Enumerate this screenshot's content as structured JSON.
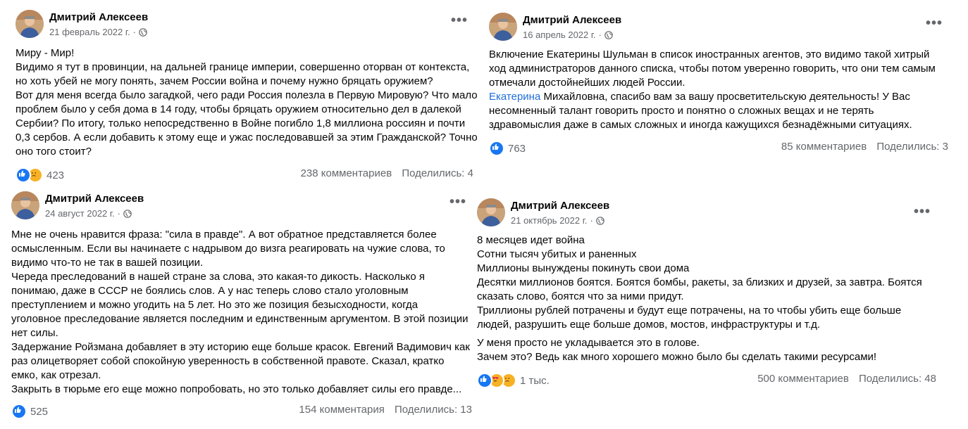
{
  "posts": [
    {
      "author": "Дмитрий Алексеев",
      "date": "21 февраль 2022 г.",
      "lines": [
        "Миру - Мир!",
        "Видимо я тут в провинции, на дальней границе империи, совершенно оторван от контекста,",
        "но хоть убей не могу понять, зачем России война и почему нужно бряцать оружием?",
        "Вот для меня всегда было загадкой, чего ради Россия полезла в Первую Мировую? Что мало",
        "проблем было у себя дома в 14 году, чтобы бряцать оружием относительно дел в далекой",
        "Сербии? По итогу, только непосредственно в Войне погибло 1,8 миллиона россиян и почти",
        "0,3 сербов. А если добавить к этому еще и ужас последовавшей за этим Гражданской? Точно",
        "оно того стоит?"
      ],
      "reaction_count": "423",
      "comments": "238 комментариев",
      "shares": "Поделились: 4"
    },
    {
      "author": "Дмитрий Алексеев",
      "date": "16 апрель 2022 г.",
      "lines": [
        "Включение Екатерины Шульман в список иностранных агентов, это видимо такой хитрый",
        "ход администраторов данного списка, чтобы потом уверенно говорить, что они тем самым",
        "отмечали достойнейших людей России."
      ],
      "link_word": "Екатерина",
      "link_line_rest": " Михайловна, спасибо вам за вашу просветительскую деятельность! У Вас",
      "lines2": [
        "несомненный талант говорить просто и понятно о сложных вещах и не терять",
        "здравомыслия даже в самых сложных и иногда кажущихся безнадёжными ситуациях."
      ],
      "reaction_count": "763",
      "comments": "85 комментариев",
      "shares": "Поделились: 3"
    },
    {
      "author": "Дмитрий Алексеев",
      "date": "24 август 2022 г.",
      "lines": [
        "Мне не очень нравится фраза: \"сила в правде\". А вот обратное представляется более",
        "осмысленным. Если вы начинаете с надрывом до визга реагировать на чужие слова, то",
        "видимо что-то не так в вашей позиции.",
        "Череда преследований в нашей стране за слова, это какая-то дикость. Насколько я",
        "понимаю, даже в СССР не боялись слов. А у нас теперь слово стало уголовным",
        "преступлением и можно угодить на 5 лет. Но это же позиция безысходности, когда",
        "уголовное преследование является последним и единственным аргументом. В этой позиции",
        "нет силы.",
        "Задержание Ройзмана добавляет в эту историю еще больше красок. Евгений Вадимович как",
        "раз олицетворяет собой спокойную уверенность в собственной правоте. Сказал, кратко",
        "емко, как отрезал.",
        "Закрыть в тюрьме его еще можно попробовать, но это только добавляет силы его правде..."
      ],
      "reaction_count": "525",
      "comments": "154 комментария",
      "shares": "Поделились: 13"
    },
    {
      "author": "Дмитрий Алексеев",
      "date": "21 октябрь 2022 г.",
      "lines": [
        "8 месяцев идет война",
        "Сотни тысяч убитых и раненных",
        "Миллионы вынуждены покинуть свои дома",
        "Десятки миллионов боятся. Боятся бомбы, ракеты, за близких и друзей, за завтра. Боятся",
        "сказать слово, боятся что за ними придут.",
        "Триллионы рублей потрачены и будут еще потрачены, на то чтобы убить еще больше",
        "людей, разрушить еще больше домов, мостов, инфраструктуры и т.д."
      ],
      "lines2": [
        "У меня просто не укладывается это в голове.",
        "Зачем это? Ведь как много хорошего можно было бы сделать такими ресурсами!"
      ],
      "reaction_count": "1 тыс.",
      "comments": "500 комментариев",
      "shares": "Поделились: 48"
    }
  ],
  "colors": {
    "like": "#1877f2",
    "sad": "#f7b125",
    "link": "#216fdb",
    "meta": "#65676b"
  },
  "icons": {
    "privacy": "globe-icon",
    "menu": "more-options-icon"
  }
}
